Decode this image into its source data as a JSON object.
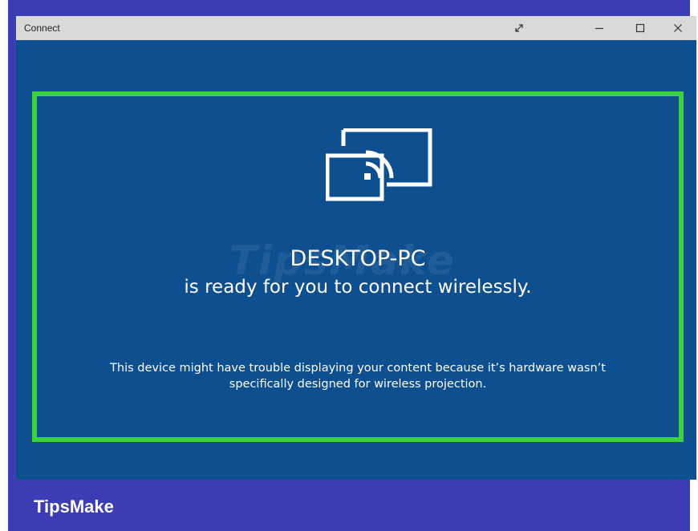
{
  "window": {
    "title": "Connect",
    "controls": {
      "expand_icon": "expand-icon",
      "minimize_icon": "minimize-icon",
      "maximize_icon": "maximize-icon",
      "close_icon": "close-icon"
    }
  },
  "main": {
    "cast_icon": "wireless-projection-icon",
    "device_name": "DESKTOP-PC",
    "status": "is ready for you to connect wirelessly.",
    "warning_line1": "This device might have trouble displaying your content because it’s hardware wasn’t",
    "warning_line2": "specifically designed for wireless projection.",
    "watermark": "TipsMake"
  },
  "banner": {
    "brand": "TipsMake"
  },
  "colors": {
    "window_bg": "#0e4f8f",
    "highlight_border": "#3ed13e",
    "banner_bg": "#3c3cb4",
    "titlebar_bg": "#d9d9d9"
  }
}
